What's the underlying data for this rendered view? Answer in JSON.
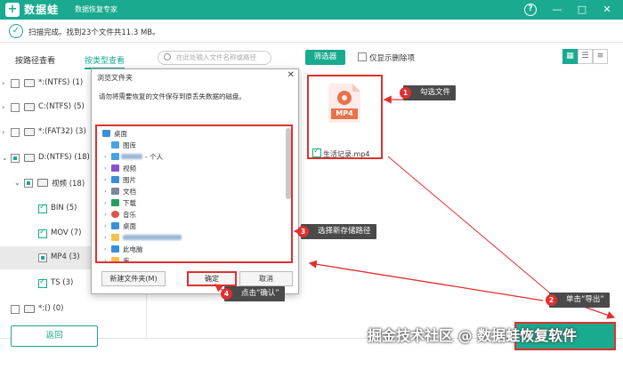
{
  "app": {
    "name": "数据蛙",
    "subtitle": "数据恢复专家"
  },
  "titlebar": {
    "help": "?",
    "minimize": "—",
    "maximize": "□",
    "close": "✕"
  },
  "status": {
    "check": "✓",
    "text": "扫描完成。找到23个文件共11.3 MB。"
  },
  "tabs": [
    {
      "label": "按路径查看"
    },
    {
      "label": "按类型查看"
    }
  ],
  "tree": [
    {
      "label": "*:(NTFS) (1)"
    },
    {
      "label": "C:(NTFS) (5)"
    },
    {
      "label": "*:(FAT32) (3)"
    },
    {
      "label": "D:(NTFS) (18)"
    },
    {
      "label": "视频 (18)"
    },
    {
      "label": "BIN (5)"
    },
    {
      "label": "MOV (7)"
    },
    {
      "label": "MP4 (3)"
    },
    {
      "label": "TS (3)"
    },
    {
      "label": "*:() (0)"
    }
  ],
  "search": {
    "placeholder": "在此处输入文件名称或路径"
  },
  "toolbar": {
    "filter": "筛选器",
    "only_deleted": "仅显示删除项"
  },
  "file": {
    "type_tag": "MP4",
    "name": "生活记录.mp4"
  },
  "dialog": {
    "title": "浏览文件夹",
    "close": "✕",
    "description": "请勿将需要恢复的文件保存到原丢失数据的磁盘。",
    "folders": [
      {
        "label": "桌面"
      },
      {
        "label": "图库"
      },
      {
        "label": "- 个人"
      },
      {
        "label": "视频"
      },
      {
        "label": "图片"
      },
      {
        "label": "文档"
      },
      {
        "label": "下载"
      },
      {
        "label": "音乐"
      },
      {
        "label": "桌面"
      },
      {
        "label": ""
      },
      {
        "label": "此电脑"
      },
      {
        "label": "库"
      }
    ],
    "new_folder": "新建文件夹(M)",
    "ok": "确定",
    "cancel": "取消"
  },
  "callouts": [
    {
      "num": "1",
      "text": "勾选文件"
    },
    {
      "num": "2",
      "text": "单击“导出”"
    },
    {
      "num": "3",
      "text": "选择新存储路径"
    },
    {
      "num": "4",
      "text": "点击“确认”"
    }
  ],
  "bottom": {
    "back": "返回"
  },
  "watermark": "掘金技术社区 @ 数据蛙恢复软件",
  "colors": {
    "accent": "#1aaa8f",
    "highlight": "#e03030",
    "callout_bg": "#4a4a4a"
  }
}
